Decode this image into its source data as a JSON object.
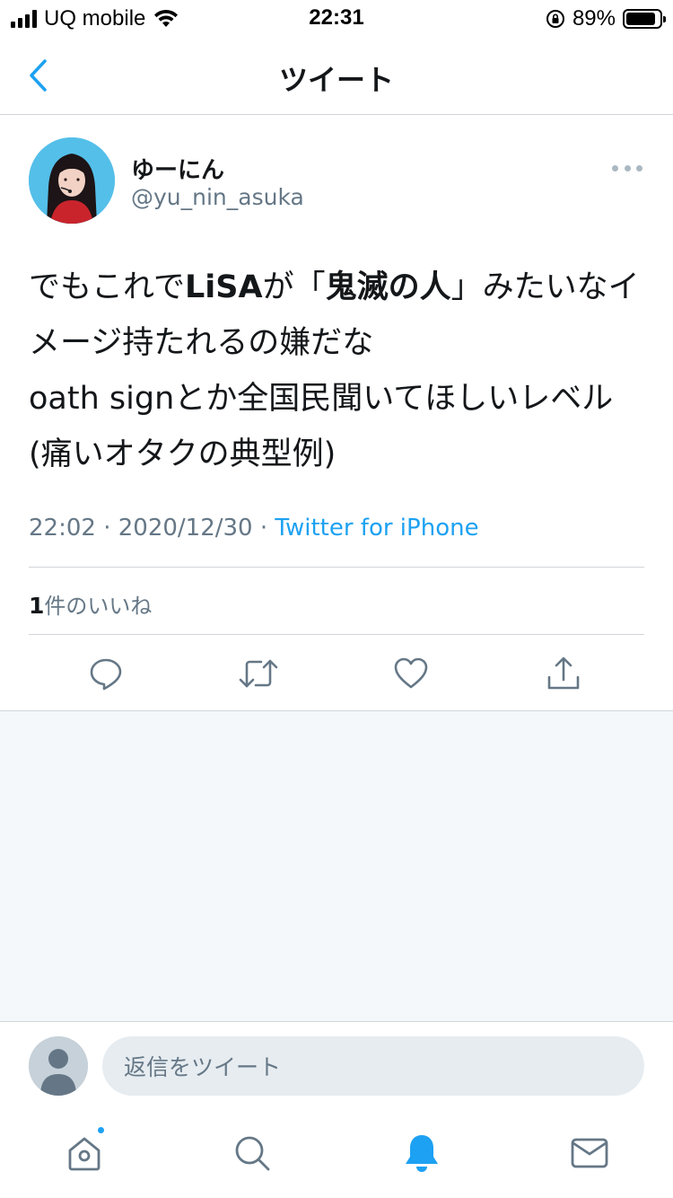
{
  "status_bar": {
    "carrier": "UQ mobile",
    "time": "22:31",
    "battery_percent": "89%",
    "battery_level": 0.89
  },
  "nav": {
    "title": "ツイート",
    "back_icon": "chevron-left-icon"
  },
  "tweet": {
    "display_name": "ゆーにん",
    "handle": "@yu_nin_asuka",
    "text_parts": {
      "p1": "でもこれで",
      "b1": "LiSA",
      "p2": "が「",
      "b2": "鬼滅の人",
      "p3": "」みたいなイメージ持たれるの嫌だな",
      "p4": "oath signとか全国民聞いてほしいレベル(痛いオタクの典型例)"
    },
    "time": "22:02",
    "date": "2020/12/30",
    "separator": "·",
    "source": "Twitter for iPhone",
    "likes_count": "1",
    "likes_label": "件のいいね"
  },
  "actions": {
    "reply_icon": "reply-icon",
    "retweet_icon": "retweet-icon",
    "like_icon": "heart-icon",
    "share_icon": "share-icon"
  },
  "reply": {
    "placeholder": "返信をツイート"
  },
  "tab_bar": {
    "items": [
      "home-icon",
      "search-icon",
      "notifications-icon",
      "messages-icon"
    ],
    "active": "notifications-icon",
    "accent_color": "#1da1f2"
  },
  "colors": {
    "accent": "#1da1f2",
    "text_primary": "#14171a",
    "text_secondary": "#657786",
    "divider": "#d0d5d9",
    "background_empty": "#f5f8fa"
  }
}
